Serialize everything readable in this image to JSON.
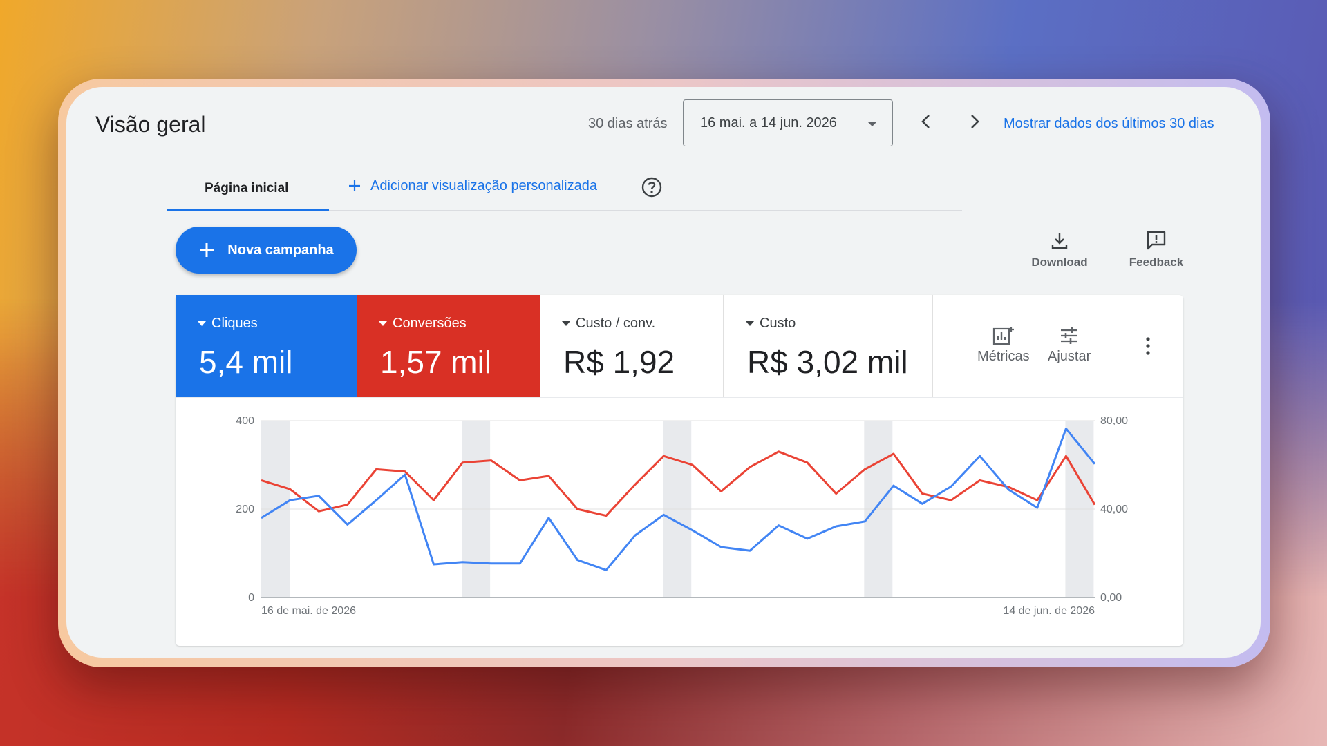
{
  "header": {
    "title": "Visão geral",
    "period_label": "30 dias atrás",
    "date_range": "16 mai. a 14 jun. 2026",
    "show_last_30": "Mostrar dados dos últimos 30 dias"
  },
  "tabs": {
    "home": "Página inicial",
    "add_view": "Adicionar visualização personalizada"
  },
  "actions": {
    "new_campaign": "Nova campanha",
    "download": "Download",
    "feedback": "Feedback"
  },
  "metrics": [
    {
      "label": "Cliques",
      "value": "5,4 mil",
      "color": "#1a73e8"
    },
    {
      "label": "Conversões",
      "value": "1,57 mil",
      "color": "#d93025"
    },
    {
      "label": "Custo / conv.",
      "value": "R$ 1,92"
    },
    {
      "label": "Custo",
      "value": "R$ 3,02 mil"
    }
  ],
  "controls": {
    "metrics": "Métricas",
    "adjust": "Ajustar"
  },
  "chart_data": {
    "type": "line",
    "x_start_label": "16 de mai. de 2026",
    "x_end_label": "14 de jun. de 2026",
    "y_left_ticks": [
      "0",
      "200",
      "400"
    ],
    "y_right_ticks": [
      "0,00",
      "40,00",
      "80,00"
    ],
    "y_left_range": [
      0,
      400
    ],
    "y_right_range": [
      0,
      80
    ],
    "weekend_day_indices": [
      0,
      7,
      14,
      21,
      28
    ],
    "series": [
      {
        "name": "Cliques",
        "color": "#4285f4",
        "axis": "left",
        "values": [
          180,
          220,
          230,
          165,
          220,
          278,
          75,
          80,
          77,
          77,
          180,
          85,
          62,
          140,
          187,
          152,
          114,
          106,
          163,
          133,
          161,
          172,
          253,
          212,
          251,
          320,
          244,
          203,
          382,
          302
        ]
      },
      {
        "name": "Conversões",
        "color": "#ea4335",
        "axis": "right",
        "values": [
          53,
          49,
          39,
          42,
          58,
          57,
          44,
          61,
          62,
          53,
          55,
          40,
          37,
          51,
          64,
          60,
          48,
          59,
          66,
          61,
          47,
          58,
          65,
          47,
          44,
          53,
          50,
          44,
          64,
          42
        ]
      }
    ]
  }
}
